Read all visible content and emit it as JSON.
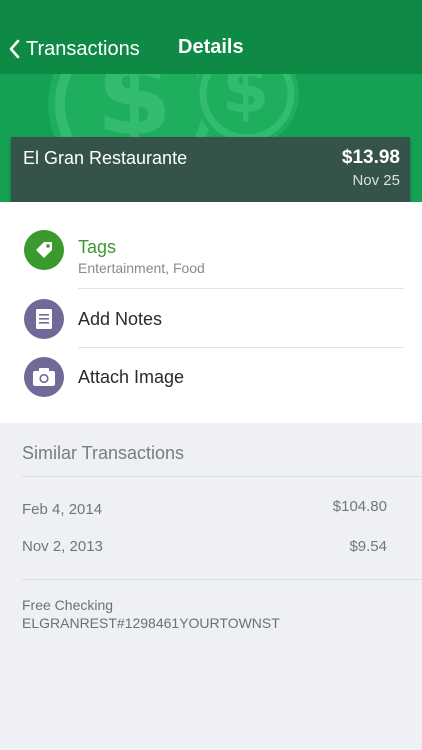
{
  "nav": {
    "back_label": "Transactions",
    "title": "Details"
  },
  "colors": {
    "nav_green": "#0e8a46",
    "hero_green": "#14a153",
    "tag_green": "#3a9a2e",
    "icon_purple": "#6f6a97"
  },
  "transaction": {
    "merchant": "El Gran Restaurante",
    "amount": "$13.98",
    "date": "Nov 25"
  },
  "rows": {
    "tags": {
      "label": "Tags",
      "value": "Entertainment, Food",
      "icon": "tag-icon"
    },
    "notes": {
      "label": "Add Notes",
      "icon": "notes-icon"
    },
    "image": {
      "label": "Attach Image",
      "icon": "camera-icon"
    }
  },
  "similar": {
    "title": "Similar Transactions",
    "items": [
      {
        "date": "Feb 4, 2014",
        "amount": "$104.80"
      },
      {
        "date": "Nov 2, 2013",
        "amount": "$9.54"
      }
    ]
  },
  "account": {
    "name": "Free Checking",
    "description": "ELGRANREST#1298461YOURTOWNST"
  }
}
